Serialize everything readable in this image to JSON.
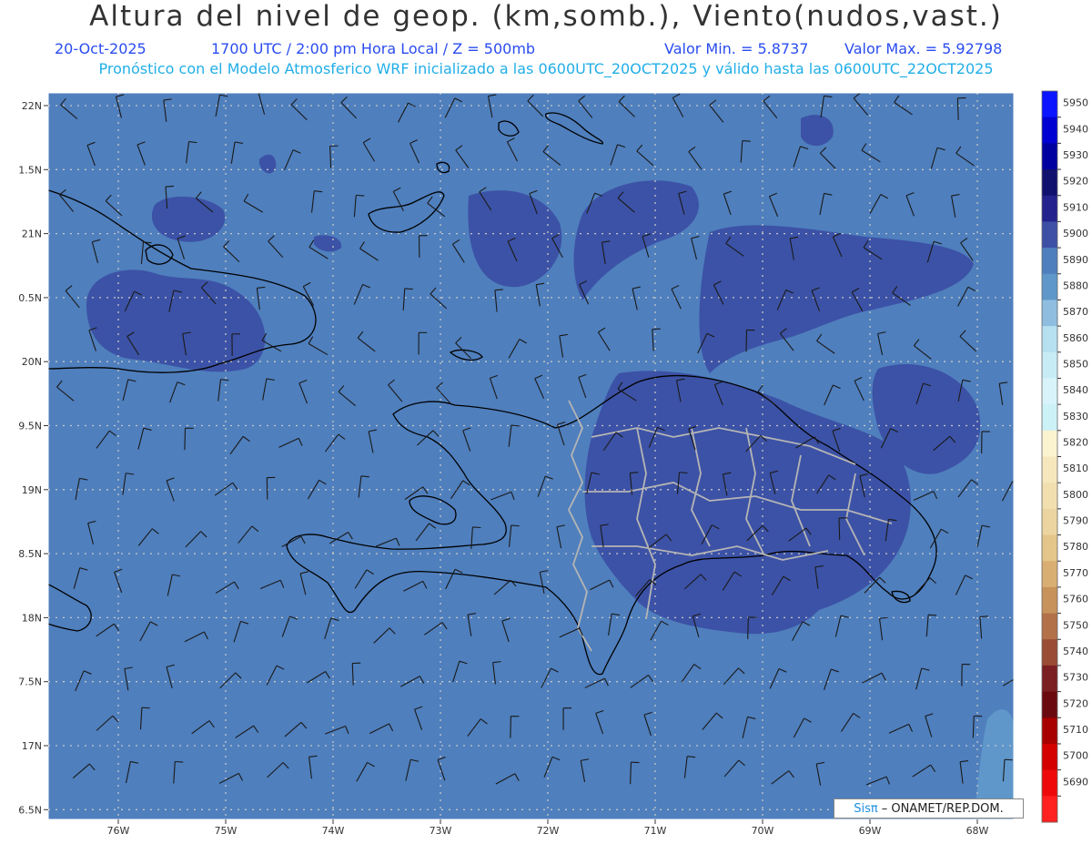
{
  "header": {
    "title": "Altura del nivel de geop. (km,somb.), Viento(nudos,vast.)",
    "date": "20-Oct-2025",
    "time": "1700 UTC / 2:00 pm Hora Local / Z = 500mb",
    "min": "Valor Min. = 5.8737",
    "max": "Valor Max. = 5.92798",
    "model_line": "Pronóstico con el Modelo Atmosferico WRF inicializado a las 0600UTC_20OCT2025 y válido hasta las  0600UTC_22OCT2025"
  },
  "axes": {
    "lat_labels": [
      "22N",
      "1.5N",
      "21N",
      "0.5N",
      "20N",
      "9.5N",
      "19N",
      "8.5N",
      "18N",
      "7.5N",
      "17N",
      "6.5N"
    ],
    "lon_labels": [
      "76W",
      "75W",
      "74W",
      "73W",
      "72W",
      "71W",
      "70W",
      "69W",
      "68W"
    ]
  },
  "colorbar": {
    "labels": [
      "5950",
      "5940",
      "5930",
      "5920",
      "5910",
      "5900",
      "5890",
      "5880",
      "5870",
      "5860",
      "5850",
      "5840",
      "5830",
      "5820",
      "5810",
      "5800",
      "5790",
      "5780",
      "5770",
      "5760",
      "5750",
      "5740",
      "5730",
      "5720",
      "5710",
      "5700",
      "5690"
    ],
    "colors": [
      "#0a14ff",
      "#0000d2",
      "#0000a0",
      "#10106e",
      "#24228c",
      "#3e4fa6",
      "#4f7fbd",
      "#5f97ca",
      "#8ebde0",
      "#b6e0f0",
      "#c8ecf6",
      "#d8f3fa",
      "#ccf2f8",
      "#fbf3d0",
      "#f6e7bd",
      "#f2dfb0",
      "#ecd4a0",
      "#e4c58a",
      "#d8ae72",
      "#c7925c",
      "#b3714a",
      "#9a4c34",
      "#7a1f22",
      "#6a0a10",
      "#a80000",
      "#d40000",
      "#ee0a0a",
      "#ff2020"
    ]
  },
  "legend": {
    "brand": "Sisπ",
    "credit": "– ONAMET/REP.DOM."
  },
  "colors": {
    "field_base": "#4f7fbd",
    "field_high": "#3c52a6",
    "field_low": "#5f97ca",
    "coast": "#000000",
    "provinces": "#b5b5b5"
  }
}
